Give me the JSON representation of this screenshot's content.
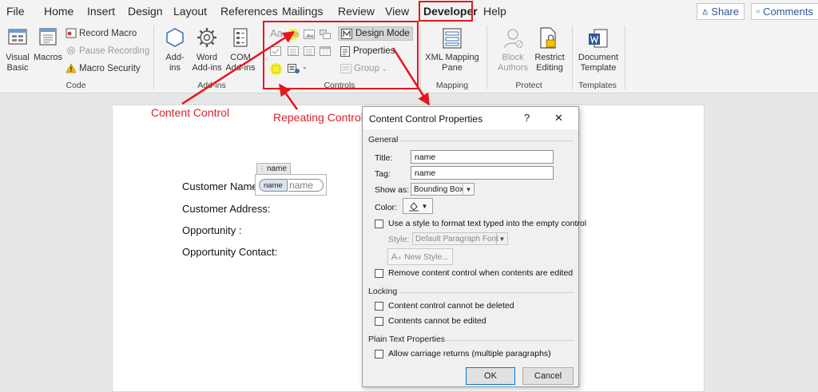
{
  "menu": {
    "tabs": [
      "File",
      "Home",
      "Insert",
      "Design",
      "Layout",
      "References",
      "Mailings",
      "Review",
      "View",
      "Developer",
      "Help"
    ],
    "active_tab": "Developer",
    "share_label": "Share",
    "comments_label": "Comments"
  },
  "ribbon": {
    "code": {
      "visual_basic_line1": "Visual",
      "visual_basic_line2": "Basic",
      "macros": "Macros",
      "record_macro": "Record Macro",
      "pause_recording": "Pause Recording",
      "macro_security": "Macro Security",
      "group_label": "Code"
    },
    "addins": {
      "addins_line1": "Add-",
      "addins_line2": "ins",
      "word_addins_line1": "Word",
      "word_addins_line2": "Add-ins",
      "com_addins_line1": "COM",
      "com_addins_line2": "Add-ins",
      "group_label": "Add-ins"
    },
    "controls": {
      "design_mode": "Design Mode",
      "properties": "Properties",
      "group": "Group",
      "group_label": "Controls",
      "aa_icon_text": "Aa"
    },
    "mapping": {
      "xml_line1": "XML Mapping",
      "xml_line2": "Pane",
      "group_label": "Mapping"
    },
    "protect": {
      "block_line1": "Block",
      "block_line2": "Authors",
      "restrict_line1": "Restrict",
      "restrict_line2": "Editing",
      "group_label": "Protect"
    },
    "templates": {
      "doc_line1": "Document",
      "doc_line2": "Template",
      "group_label": "Templates"
    }
  },
  "annotations": {
    "content_control": "Content Control",
    "repeating_control": "Repeating Control"
  },
  "document": {
    "fields": [
      "Customer Name:",
      "Customer Address:",
      "Opportunity :",
      "Opportunity Contact:"
    ],
    "cc_tag": "name",
    "cc_title": "name",
    "cc_placeholder": "name"
  },
  "dialog": {
    "title": "Content Control Properties",
    "help": "?",
    "close": "✕",
    "general_section": "General",
    "title_label": "Title:",
    "title_value": "name",
    "tag_label": "Tag:",
    "tag_value": "name",
    "show_as_label": "Show as:",
    "show_as_value": "Bounding Box",
    "color_label": "Color:",
    "use_style_label": "Use a style to format text typed into the empty control",
    "style_label": "Style:",
    "style_value": "Default Paragraph Font",
    "new_style_label": "New Style...",
    "remove_cc_label": "Remove content control when contents are edited",
    "locking_section": "Locking",
    "cannot_delete_label": "Content control cannot be deleted",
    "cannot_edit_label": "Contents cannot be edited",
    "plain_text_section": "Plain Text Properties",
    "allow_cr_label": "Allow carriage returns (multiple paragraphs)",
    "ok": "OK",
    "cancel": "Cancel"
  },
  "colors": {
    "accent_red": "#e8151c",
    "word_blue": "#2b579a",
    "highlight_yellow": "#f6f13a"
  }
}
